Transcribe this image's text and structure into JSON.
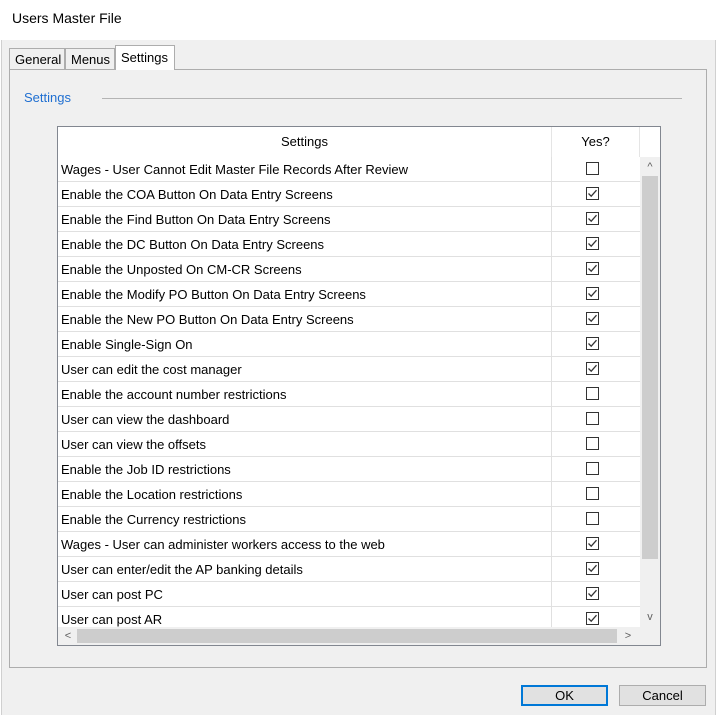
{
  "window": {
    "title": "Users Master File"
  },
  "tabs": [
    {
      "label": "General",
      "active": false
    },
    {
      "label": "Menus",
      "active": false
    },
    {
      "label": "Settings",
      "active": true
    }
  ],
  "group": {
    "label": "Settings"
  },
  "grid": {
    "columns": {
      "setting": "Settings",
      "yes": "Yes?"
    },
    "rows": [
      {
        "label": "Wages - User Cannot Edit Master File Records After Review",
        "checked": false
      },
      {
        "label": "Enable the COA Button On Data Entry Screens",
        "checked": true
      },
      {
        "label": "Enable the Find Button On Data Entry Screens",
        "checked": true
      },
      {
        "label": "Enable the DC Button On Data Entry Screens",
        "checked": true
      },
      {
        "label": "Enable the Unposted On CM-CR Screens",
        "checked": true
      },
      {
        "label": "Enable the Modify PO Button On Data Entry Screens",
        "checked": true
      },
      {
        "label": "Enable the New PO Button On Data Entry Screens",
        "checked": true
      },
      {
        "label": "Enable Single-Sign On",
        "checked": true
      },
      {
        "label": "User can edit the cost manager",
        "checked": true
      },
      {
        "label": "Enable the account number restrictions",
        "checked": false
      },
      {
        "label": "User can view the dashboard",
        "checked": false
      },
      {
        "label": "User can view the offsets",
        "checked": false
      },
      {
        "label": "Enable the Job ID restrictions",
        "checked": false
      },
      {
        "label": "Enable the Location restrictions",
        "checked": false
      },
      {
        "label": "Enable the Currency restrictions",
        "checked": false
      },
      {
        "label": "Wages - User can administer workers access to the web",
        "checked": true
      },
      {
        "label": "User can enter/edit the AP banking details",
        "checked": true
      },
      {
        "label": "User can post PC",
        "checked": true
      },
      {
        "label": "User can post AR",
        "checked": true
      }
    ]
  },
  "scroll": {
    "up": "^",
    "down": "v",
    "left": "<",
    "right": ">"
  },
  "buttons": {
    "ok": "OK",
    "cancel": "Cancel"
  },
  "colors": {
    "accent": "#0078d7",
    "group_label": "#1f6fd1"
  }
}
